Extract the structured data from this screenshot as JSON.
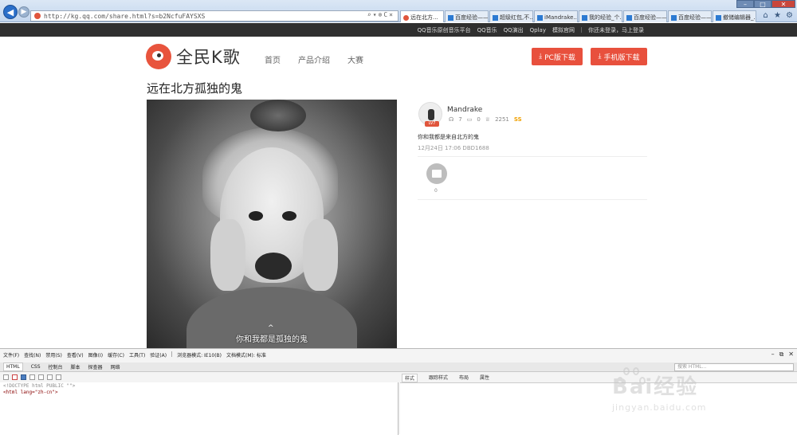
{
  "browser": {
    "url": "http://kg.qq.com/share.html?s=b2NcfuFAYSXS",
    "tabs": [
      {
        "label": "远在北方...",
        "active": true,
        "icon": "qq-favicon"
      },
      {
        "label": "百度经验——",
        "active": false,
        "icon": "baidu-favicon"
      },
      {
        "label": "超级红包,不...",
        "active": false,
        "icon": "baidu-favicon"
      },
      {
        "label": "iMandrake...",
        "active": false,
        "icon": "baidu-favicon"
      },
      {
        "label": "我的经验_个...",
        "active": false,
        "icon": "baidu-favicon"
      },
      {
        "label": "百度经验——",
        "active": false,
        "icon": "baidu-favicon"
      },
      {
        "label": "百度经验——",
        "active": false,
        "icon": "baidu-favicon"
      },
      {
        "label": "撤储编辑器_...",
        "active": false,
        "icon": "baidu-favicon"
      }
    ]
  },
  "site_bar": {
    "links": [
      "QQ音乐原创音乐平台",
      "QQ音乐",
      "QQ演出",
      "Qplay",
      "模拟官网"
    ],
    "login_status": "你还未登录，",
    "login_link": "马上登录"
  },
  "header": {
    "logo_text": "全民K歌",
    "nav": [
      "首页",
      "产品介绍",
      "大赛"
    ],
    "pc_download": "PC版下载",
    "mobile_download": "手机版下载"
  },
  "song": {
    "title": "远在北方孤独的鬼",
    "lyric": "你和我都是孤独的鬼",
    "lyric_up_icon": "^"
  },
  "user": {
    "name": "Mandrake",
    "level": "LV7",
    "listens": "7",
    "comments": "0",
    "gifts": "2251",
    "rank": "SS",
    "description": "你和我都是来自北方的鬼",
    "timestamp": "12月24日 17:06 DBD1688",
    "gift_count": "0"
  },
  "devtools": {
    "menu": [
      "文件(F)",
      "查找(N)",
      "禁用(S)",
      "查看(V)",
      "图像(I)",
      "缓存(C)",
      "工具(T)",
      "验证(A)",
      "浏览器模式: IE10(B)",
      "文档模式(M): 标准"
    ],
    "tabs": [
      "HTML",
      "CSS",
      "控制台",
      "脚本",
      "探查器",
      "网络"
    ],
    "search_placeholder": "搜索 HTML...",
    "code_line1": "<!DOCTYPE html PUBLIC \"\">",
    "code_line2": "<html lang=\"zh-cn\">",
    "right_tabs": [
      "样式",
      "跟踪样式",
      "布局",
      "属性"
    ]
  },
  "watermark": {
    "brand": "Bai经验",
    "url": "jingyan.baidu.com"
  }
}
